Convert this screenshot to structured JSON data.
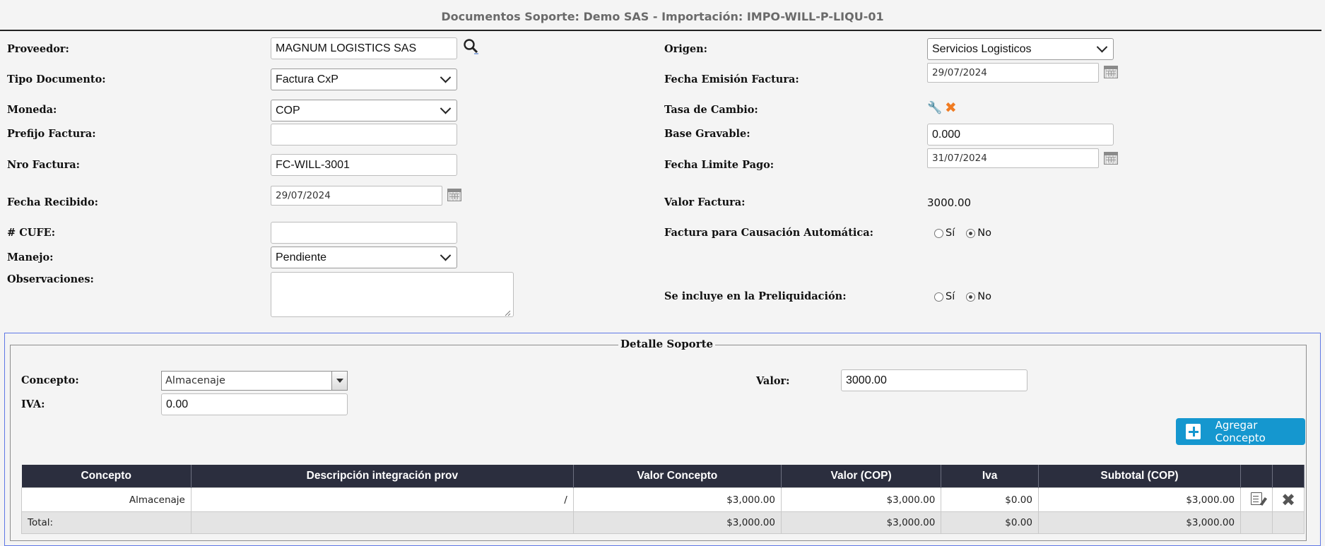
{
  "header": {
    "title": "Documentos Soporte: Demo SAS - Importación: IMPO-WILL-P-LIQU-01"
  },
  "left": {
    "proveedor": {
      "label": "Proveedor:",
      "value": "MAGNUM LOGISTICS SAS"
    },
    "tipo_documento": {
      "label": "Tipo Documento:",
      "value": "Factura CxP"
    },
    "moneda": {
      "label": "Moneda:",
      "value": "COP"
    },
    "prefijo": {
      "label": "Prefijo Factura:",
      "value": ""
    },
    "nro_factura": {
      "label": "Nro Factura:",
      "value": "FC-WILL-3001"
    },
    "fecha_recibido": {
      "label": "Fecha Recibido:",
      "value": "29/07/2024"
    },
    "cufe": {
      "label": "# CUFE:",
      "value": ""
    },
    "manejo": {
      "label": "Manejo:",
      "value": "Pendiente"
    },
    "observaciones": {
      "label": "Observaciones:",
      "value": ""
    }
  },
  "right": {
    "origen": {
      "label": "Origen:",
      "value": "Servicios Logisticos"
    },
    "fecha_emision": {
      "label": "Fecha Emisión Factura:",
      "value": "29/07/2024"
    },
    "tasa": {
      "label": "Tasa de Cambio:"
    },
    "base_gravable": {
      "label": "Base Gravable:",
      "value": "0.000"
    },
    "fecha_limite": {
      "label": "Fecha Limite Pago:",
      "value": "31/07/2024"
    },
    "valor_factura": {
      "label": "Valor Factura:",
      "value": "3000.00"
    },
    "causacion": {
      "label": "Factura para Causación Automática:",
      "opt_si": "Sí",
      "opt_no": "No",
      "selected": "No"
    },
    "preliquidacion": {
      "label": "Se incluye en la Preliquidación:",
      "opt_si": "Sí",
      "opt_no": "No",
      "selected": "No"
    }
  },
  "detalle": {
    "legend": "Detalle Soporte",
    "concepto": {
      "label": "Concepto:",
      "value": "Almacenaje"
    },
    "valor": {
      "label": "Valor:",
      "value": "3000.00"
    },
    "iva": {
      "label": "IVA:",
      "value": "0.00"
    },
    "add_label": "Agregar Concepto",
    "table": {
      "headers": [
        "Concepto",
        "Descripción integración prov",
        "Valor Concepto",
        "Valor (COP)",
        "Iva",
        "Subtotal (COP)",
        "",
        ""
      ],
      "rows": [
        {
          "concepto": "Almacenaje",
          "descripcion": "/",
          "valor_concepto": "$3,000.00",
          "valor_cop": "$3,000.00",
          "iva": "$0.00",
          "subtotal": "$3,000.00"
        }
      ],
      "total": {
        "label": "Total:",
        "valor_concepto": "$3,000.00",
        "valor_cop": "$3,000.00",
        "iva": "$0.00",
        "subtotal": "$3,000.00"
      }
    }
  },
  "icons": {
    "search": "magnifier-icon",
    "calendar": "calendar-icon",
    "wrench": "wrench-icon",
    "clear": "clear-x-icon",
    "edit": "edit-document-icon",
    "delete": "delete-x-icon"
  },
  "colors": {
    "accent": "#1597cf",
    "header_dark": "#2b2e3e",
    "section_border": "#5f78e6"
  }
}
